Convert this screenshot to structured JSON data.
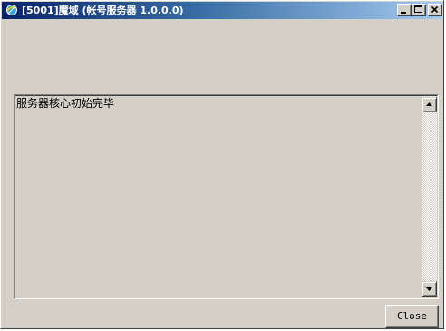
{
  "window": {
    "title": "[5001]魔域 (帐号服务器 1.0.0.0)",
    "controls": {
      "minimize_icon": "minimize-icon",
      "maximize_icon": "maximize-icon",
      "close_icon": "close-icon"
    }
  },
  "log": {
    "text": "服务器核心初始完毕"
  },
  "footer": {
    "close_label": "Close"
  },
  "colors": {
    "face": "#d4d0c8",
    "title_active_start": "#0a246a",
    "title_active_end": "#a6caf0"
  }
}
